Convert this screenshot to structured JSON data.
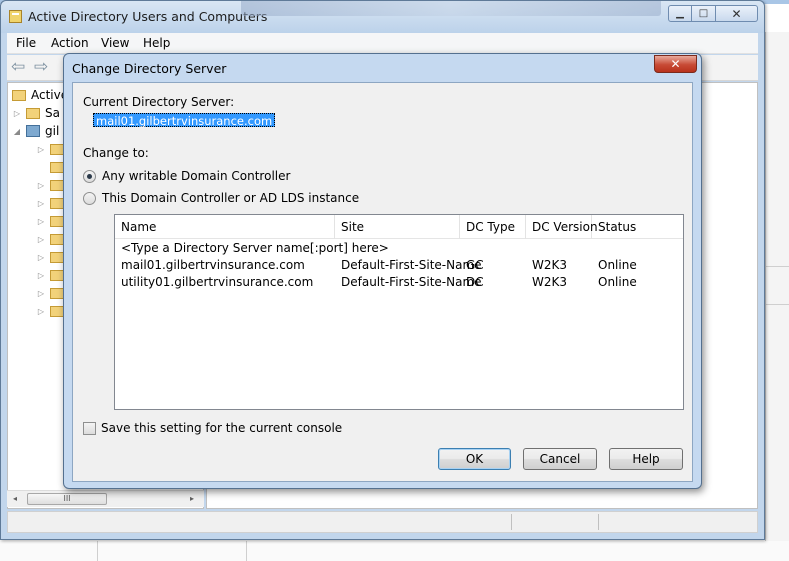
{
  "main_window": {
    "title": "Active Directory Users and Computers",
    "menu": [
      "File",
      "Action",
      "View",
      "Help"
    ]
  },
  "tree": {
    "root_label": "Active",
    "saved_label": "Sa",
    "domain_label": "gil"
  },
  "scroll_thumb_text": "III",
  "dialog": {
    "title": "Change Directory Server",
    "close_glyph": "✕",
    "current_label": "Current Directory Server:",
    "current_value": "mail01.gilbertrvinsurance.com",
    "change_to_label": "Change to:",
    "radio_any": "Any writable Domain Controller",
    "radio_this": "This Domain Controller or AD LDS instance",
    "columns": [
      "Name",
      "Site",
      "DC Type",
      "DC Version",
      "Status"
    ],
    "placeholder_row": "<Type a Directory Server name[:port] here>",
    "rows": [
      [
        "mail01.gilbertrvinsurance.com",
        "Default-First-Site-Name",
        "GC",
        "W2K3",
        "Online"
      ],
      [
        "utility01.gilbertrvinsurance.com",
        "Default-First-Site-Name",
        "DC",
        "W2K3",
        "Online"
      ]
    ],
    "save_setting_label": "Save this setting for the current console",
    "ok_label": "OK",
    "cancel_label": "Cancel",
    "help_label": "Help"
  }
}
